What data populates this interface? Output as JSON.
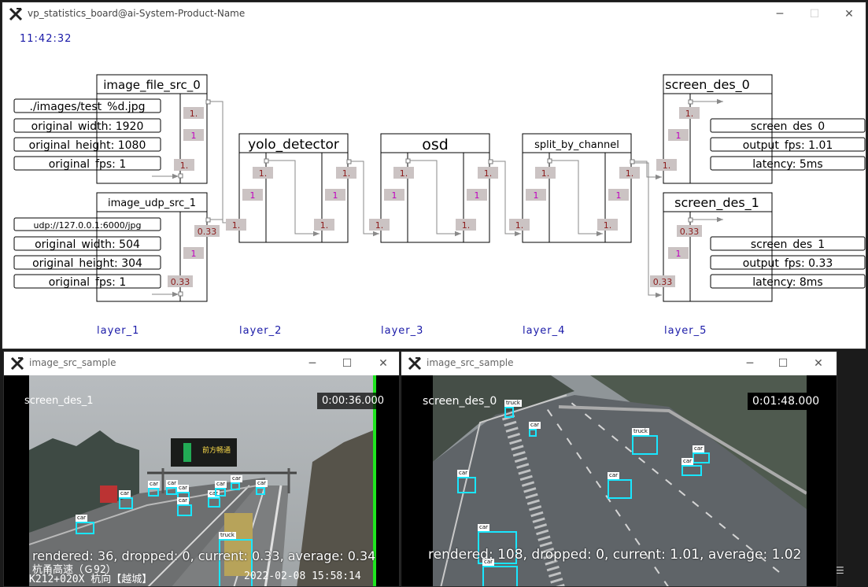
{
  "main_window": {
    "title": "vp_statistics_board@ai-System-Product-Name",
    "clock": "11:42:32",
    "nodes": {
      "src0": {
        "name": "image_file_src_0",
        "props": [
          "./images/test_%d.jpg",
          "original_width: 1920",
          "original_height: 1080",
          "original_fps: 1"
        ],
        "out": "1.",
        "mid": "1",
        "in": "1."
      },
      "src1": {
        "name": "image_udp_src_1",
        "props": [
          "udp://127.0.0.1:6000/jpg",
          "original_width: 504",
          "original_height: 304",
          "original_fps: 1"
        ],
        "out": "0.33",
        "mid": "1",
        "in": "0.33"
      },
      "yolo": {
        "name": "yolo_detector",
        "in": "1.",
        "ltop": "1.",
        "lmid": "1",
        "rtop": "1.",
        "rmid": "1",
        "rbot": "1."
      },
      "osd": {
        "name": "osd",
        "in": "1.",
        "ltop": "1.",
        "lmid": "1",
        "rtop": "1.",
        "rmid": "1",
        "rbot": "1."
      },
      "split": {
        "name": "split_by_channel",
        "in": "1.",
        "ltop": "1.",
        "lmid": "1",
        "rtop": "1.",
        "rmid": "1",
        "rbot": "1."
      },
      "des0": {
        "name": "screen_des_0",
        "props": [
          "screen_des_0",
          "output_fps: 1.01",
          "latency: 5ms"
        ],
        "top": "1.",
        "mid": "1",
        "in": "1."
      },
      "des1": {
        "name": "screen_des_1",
        "props": [
          "screen_des_1",
          "output_fps: 0.33",
          "latency: 8ms"
        ],
        "top": "0.33",
        "mid": "1",
        "in": "0.33"
      }
    },
    "layers": [
      "layer_1",
      "layer_2",
      "layer_3",
      "layer_4",
      "layer_5"
    ]
  },
  "left_window": {
    "title": "image_src_sample",
    "channel_label": "screen_des_1",
    "timecode": "0:00:36.000",
    "stats": "rendered: 36, dropped: 0, current: 0.33, average: 0.34",
    "osd_line1": "杭甬高速（Ｇ92）",
    "osd_line2": "K212+020X 杭向【越城】",
    "osd_date": "2022-02-08 15:58:14",
    "sign_text": "前方畅通",
    "detections": [
      "car",
      "car",
      "car",
      "car",
      "car",
      "car",
      "car",
      "car",
      "car",
      "car",
      "truck"
    ]
  },
  "right_window": {
    "title": "image_src_sample",
    "channel_label": "screen_des_0",
    "timecode": "0:01:48.000",
    "stats": "rendered: 108, dropped: 0, current: 1.01, average: 1.02",
    "detections": [
      "truck",
      "car",
      "truck",
      "car",
      "car",
      "car",
      "car",
      "car",
      "car",
      "car"
    ]
  },
  "colors": {
    "layer_text": "#1a1aa8",
    "port_fill": "#cbc3c3",
    "port_text": "#8c1a1a",
    "mid_text": "#c000c0",
    "box_cyan": "#19e6ff"
  }
}
